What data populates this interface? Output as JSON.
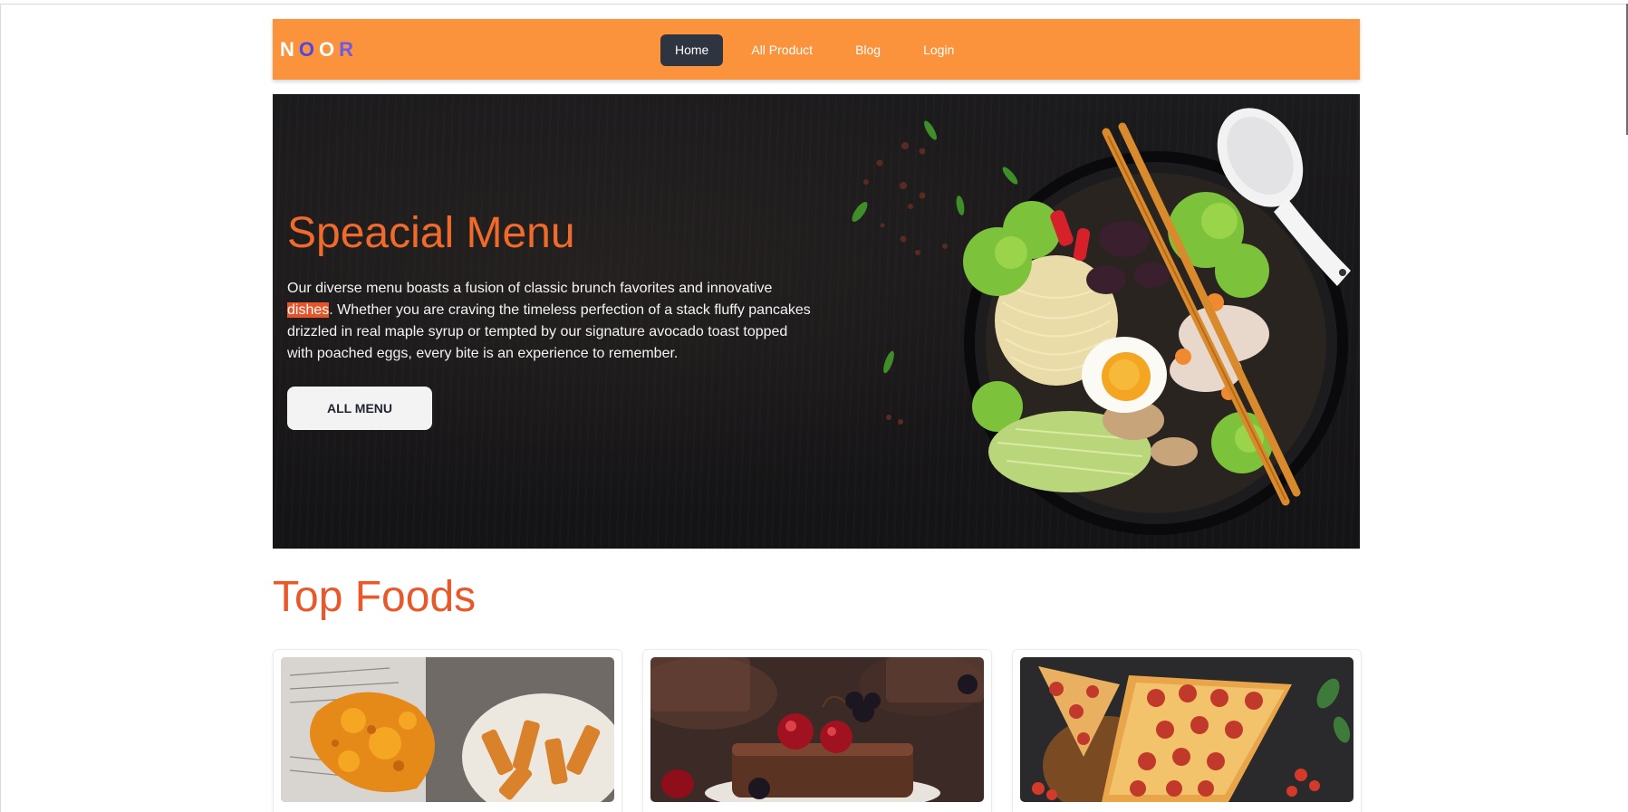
{
  "brand": {
    "letters": [
      {
        "char": "N",
        "color": "#ffffff"
      },
      {
        "char": "O",
        "color": "#4f46e5"
      },
      {
        "char": "O",
        "color": "#ffffff"
      },
      {
        "char": "R",
        "color": "#6d5ae6"
      }
    ]
  },
  "nav": {
    "items": [
      {
        "label": "Home",
        "active": true
      },
      {
        "label": "All Product",
        "active": false
      },
      {
        "label": "Blog",
        "active": false
      },
      {
        "label": "Login",
        "active": false
      }
    ]
  },
  "hero": {
    "title": "Speacial Menu",
    "text_before": "Our diverse menu boasts a fusion of classic brunch favorites and innovative ",
    "highlight": "dishes",
    "text_after": ". Whether you are craving the timeless perfection of a stack fluffy pancakes drizzled in real maple syrup or tempted by our signature avocado toast topped with poached eggs, every bite is an experience to remember.",
    "button_label": "ALL MENU"
  },
  "top_foods": {
    "title": "Top Foods",
    "cards": [
      {
        "image": "fried-fish-and-chips"
      },
      {
        "image": "chocolate-cake-with-cherries"
      },
      {
        "image": "pepperoni-pizza"
      }
    ]
  },
  "colors": {
    "navbar": "#fb923c",
    "accent": "#f06a2b",
    "active_nav": "#2e3440"
  }
}
